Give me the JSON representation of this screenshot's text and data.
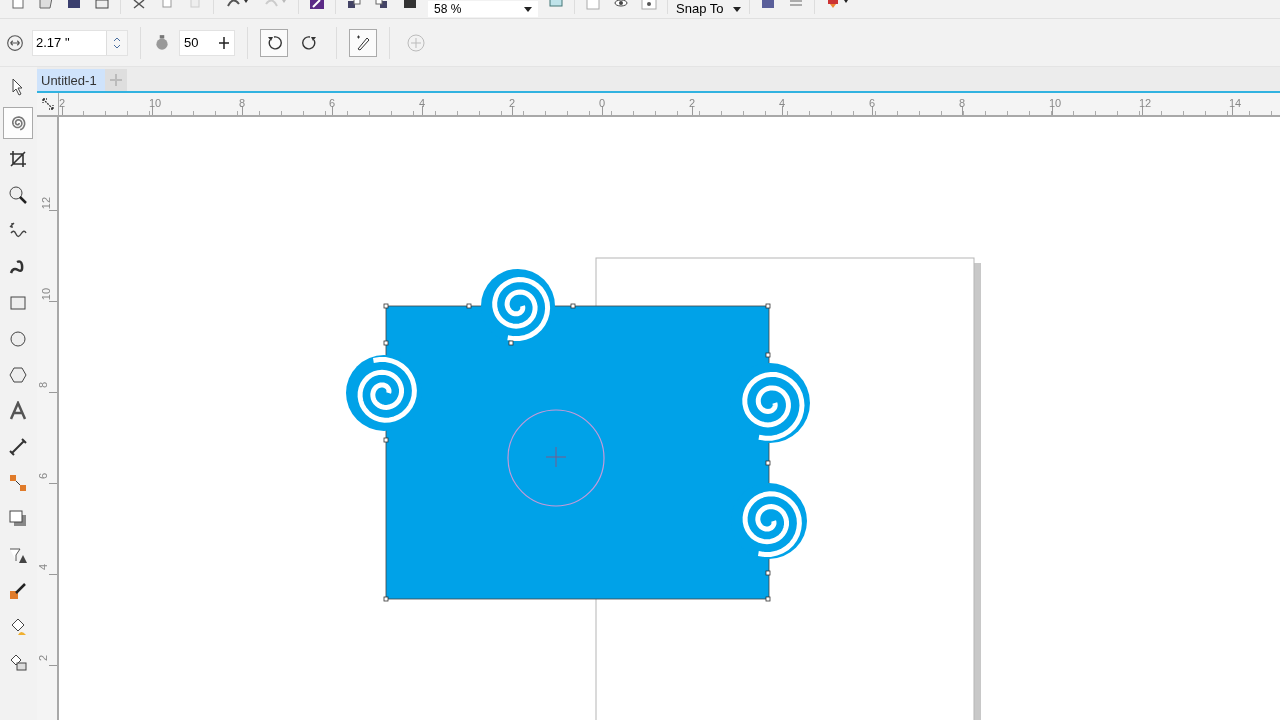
{
  "toolbar": {
    "zoom": "58 %",
    "snap": "Snap To"
  },
  "property_bar": {
    "field_1": "2.17 \"",
    "field_2": "50"
  },
  "tabs": [
    {
      "label": "Untitled-1",
      "selected": true
    }
  ],
  "rulers": {
    "horizontal": [
      "2",
      "10",
      "8",
      "6",
      "4",
      "2",
      "0",
      "2",
      "4",
      "6",
      "8",
      "10",
      "12",
      "14"
    ],
    "vertical": [
      "12",
      "10",
      "8",
      "6",
      "4",
      "2"
    ]
  },
  "tools": [
    {
      "kind": "pick",
      "selected": false
    },
    {
      "kind": "spiral",
      "selected": true
    },
    {
      "kind": "crop",
      "selected": false
    },
    {
      "kind": "zoom",
      "selected": false
    },
    {
      "kind": "freehand",
      "selected": false
    },
    {
      "kind": "artistic",
      "selected": false
    },
    {
      "kind": "rectangle",
      "selected": false
    },
    {
      "kind": "ellipse",
      "selected": false
    },
    {
      "kind": "polygon",
      "selected": false
    },
    {
      "kind": "text",
      "selected": false
    },
    {
      "kind": "dimension",
      "selected": false
    },
    {
      "kind": "connector",
      "selected": false
    },
    {
      "kind": "shadow",
      "selected": false
    },
    {
      "kind": "transparency",
      "selected": false
    },
    {
      "kind": "eyedropper",
      "selected": false
    },
    {
      "kind": "fill",
      "selected": false
    },
    {
      "kind": "smartfill",
      "selected": false
    }
  ]
}
